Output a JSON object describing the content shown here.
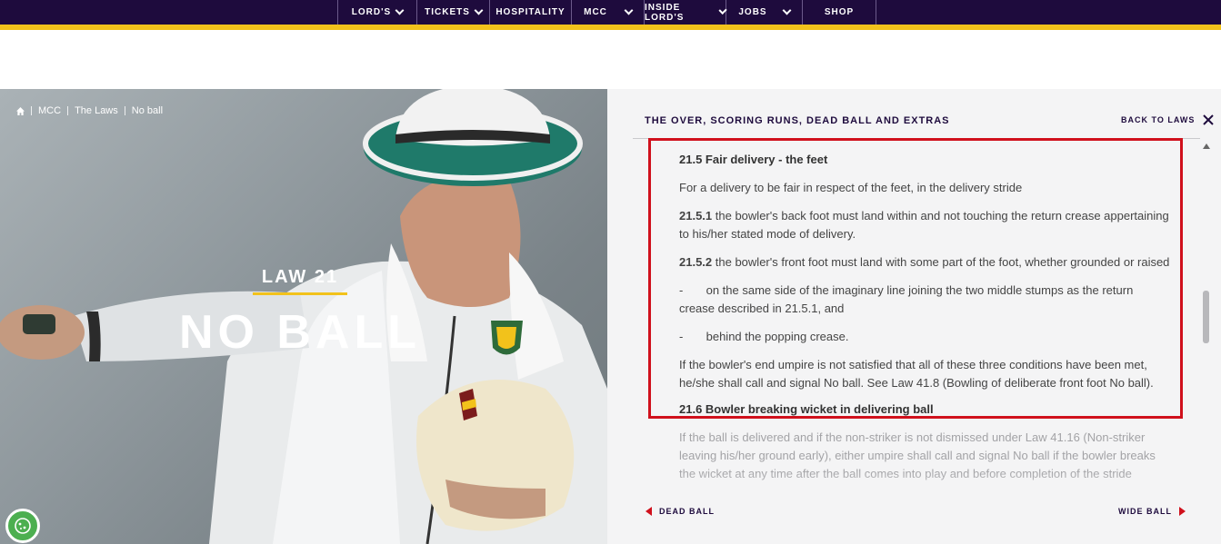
{
  "nav": {
    "items": [
      {
        "label": "LORD'S",
        "dropdown": true
      },
      {
        "label": "TICKETS",
        "dropdown": true
      },
      {
        "label": "HOSPITALITY",
        "dropdown": false
      },
      {
        "label": "MCC",
        "dropdown": true
      },
      {
        "label": "INSIDE LORD'S",
        "dropdown": true
      },
      {
        "label": "JOBS",
        "dropdown": true
      },
      {
        "label": "SHOP",
        "dropdown": false
      }
    ]
  },
  "breadcrumb": {
    "home_icon": "home-icon",
    "items": [
      "MCC",
      "The Laws",
      "No ball"
    ]
  },
  "hero": {
    "law_label": "LAW 21",
    "law_title": "NO BALL"
  },
  "panel": {
    "section_title": "THE OVER, SCORING RUNS, DEAD BALL AND EXTRAS",
    "back_label": "BACK TO LAWS",
    "content": {
      "h_21_5": "21.5 Fair delivery - the feet",
      "p_intro": "For a delivery to be fair in respect of the feet, in the delivery stride",
      "c_21_5_1_num": "21.5.1",
      "c_21_5_1_text": " the bowler's back foot must land within and not touching the return crease appertaining to his/her stated mode of delivery.",
      "c_21_5_2_num": "21.5.2",
      "c_21_5_2_text": " the bowler's front foot must land with some part of the foot, whether grounded or raised",
      "bullet_1": "-       on the same side of the imaginary line joining the two middle stumps as the return crease described in 21.5.1, and",
      "bullet_2": "-       behind the popping crease.",
      "p_conditions": "If the bowler's end umpire is not satisfied that all of these three conditions have been met, he/she shall call and signal No ball.  See Law 41.8 (Bowling of deliberate front foot No ball).",
      "h_21_6": "21.6 Bowler breaking wicket in delivering ball",
      "p_21_6": "If the ball is delivered and if the non-striker is not dismissed under Law 41.16 (Non-striker leaving his/her ground early), either umpire shall call and signal No ball if the bowler breaks the wicket at any time after the ball comes into play and before completion of the stride"
    },
    "prev_label": "DEAD BALL",
    "next_label": "WIDE BALL"
  },
  "colors": {
    "nav_bg": "#1e0b3d",
    "accent_yellow": "#f2c21b",
    "highlight_red": "#d0101c"
  }
}
